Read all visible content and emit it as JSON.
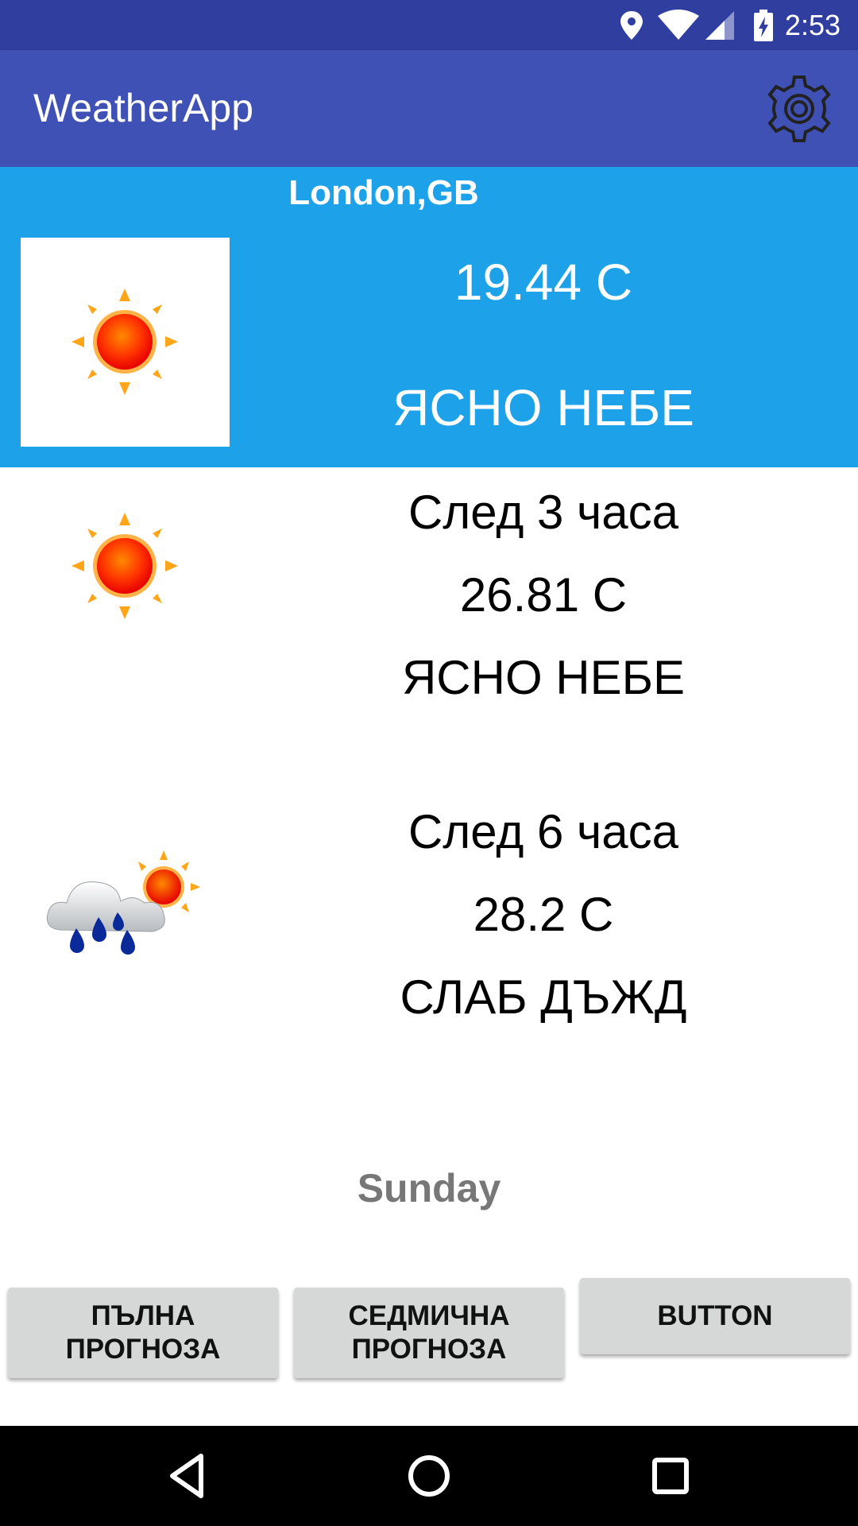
{
  "status_bar": {
    "time": "2:53",
    "icons": [
      "location-icon",
      "wifi-icon",
      "cell-signal-icon",
      "battery-charging-icon"
    ]
  },
  "app_bar": {
    "title": "WeatherApp",
    "settings_icon": "gear-icon"
  },
  "current": {
    "city": "London,GB",
    "temperature": "19.44 C",
    "description": "ЯСНО НЕБЕ",
    "icon": "sun-icon",
    "background_color": "#1da1e8"
  },
  "forecasts": [
    {
      "label": "След 3 часа",
      "temperature": "26.81 C",
      "description": "ЯСНО НЕБЕ",
      "icon": "sun-icon"
    },
    {
      "label": "След 6 часа",
      "temperature": "28.2 C",
      "description": "СЛАБ ДЪЖД",
      "icon": "light-rain-icon"
    }
  ],
  "day": "Sunday",
  "buttons": {
    "full_forecast": [
      "ПЪЛНА",
      "ПРОГНОЗА"
    ],
    "weekly_forecast": [
      "СЕДМИЧНА",
      "ПРОГНОЗА"
    ],
    "button": "BUTTON"
  },
  "nav": [
    "back-icon",
    "home-icon",
    "recents-icon"
  ],
  "colors": {
    "primary_dark": "#303f9f",
    "primary": "#3f51b5",
    "accent_panel": "#1da1e8"
  }
}
